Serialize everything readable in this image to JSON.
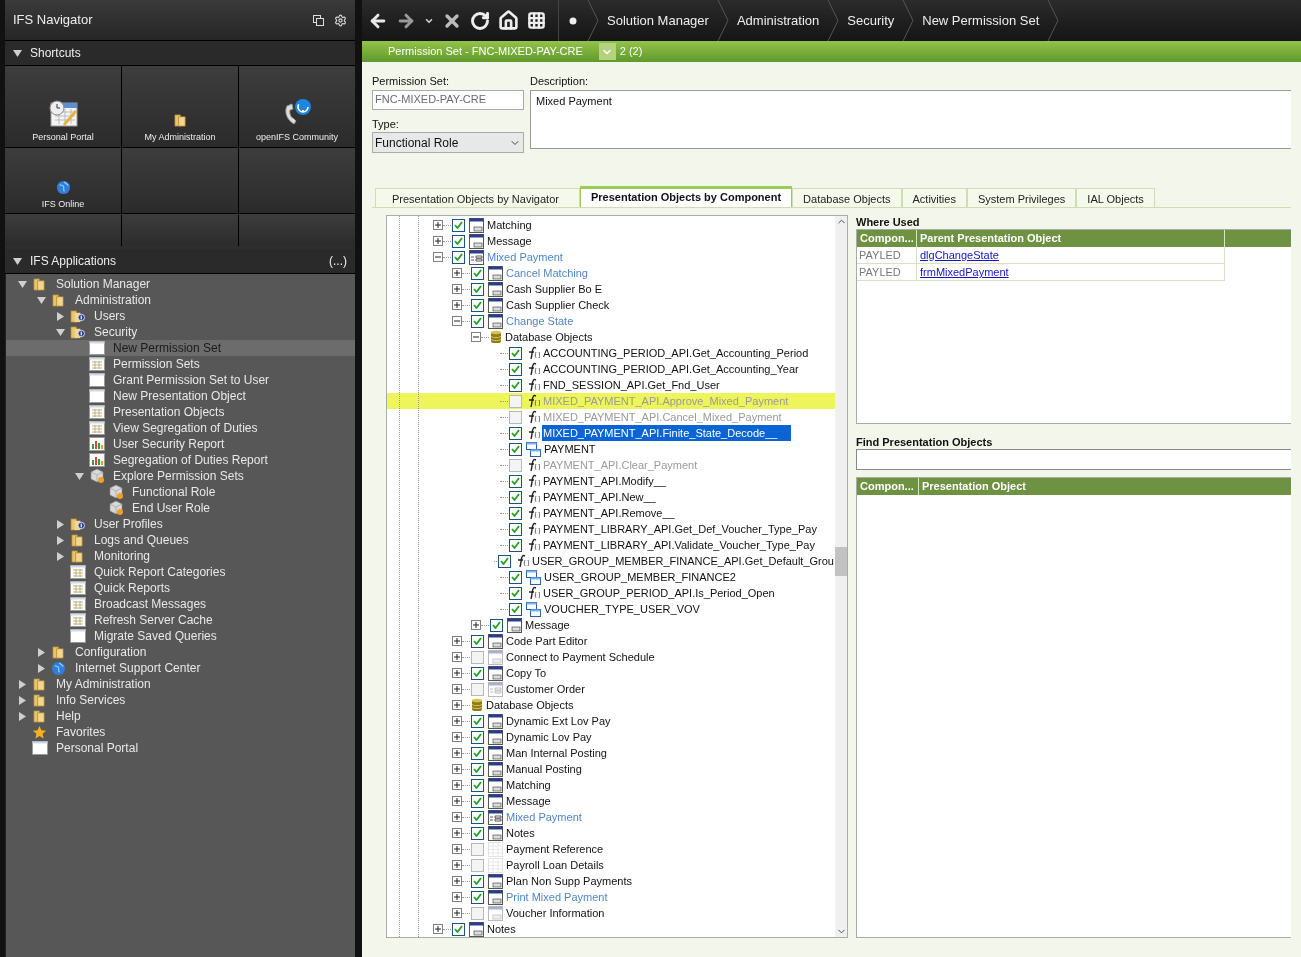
{
  "navigator": {
    "title": "IFS Navigator"
  },
  "shortcuts": {
    "title": "Shortcuts",
    "expanded": true,
    "items": [
      {
        "label": "Personal Portal",
        "kind": "calendar"
      },
      {
        "label": "My Administration",
        "kind": "folder"
      },
      {
        "label": "openIFS Community",
        "kind": "phone"
      },
      {
        "label": "IFS Online",
        "kind": "globe"
      }
    ]
  },
  "applications": {
    "title": "IFS Applications",
    "expanded": true,
    "more": "(...)",
    "items": [
      {
        "label": "Solution Manager",
        "kind": "folder",
        "expanded": true,
        "selected": false,
        "children": [
          {
            "label": "Administration",
            "kind": "folder",
            "expanded": true,
            "selected": false,
            "children": [
              {
                "label": "Users",
                "kind": "folder-info",
                "expanded": false,
                "selected": false
              },
              {
                "label": "Security",
                "kind": "folder-info",
                "expanded": true,
                "selected": false,
                "children": [
                  {
                    "label": "New Permission Set",
                    "kind": "window",
                    "selected": true
                  },
                  {
                    "label": "Permission Sets",
                    "kind": "grid",
                    "selected": false
                  },
                  {
                    "label": "Grant Permission Set to User",
                    "kind": "window",
                    "selected": false
                  },
                  {
                    "label": "New Presentation Object",
                    "kind": "window",
                    "selected": false
                  },
                  {
                    "label": "Presentation Objects",
                    "kind": "grid",
                    "selected": false
                  },
                  {
                    "label": "View Segregation of Duties",
                    "kind": "grid",
                    "selected": false
                  },
                  {
                    "label": "User Security Report",
                    "kind": "report",
                    "selected": false
                  },
                  {
                    "label": "Segregation of Duties Report",
                    "kind": "report",
                    "selected": false
                  },
                  {
                    "label": "Explore Permission Sets",
                    "kind": "cube",
                    "expanded": true,
                    "selected": false,
                    "children": [
                      {
                        "label": "Functional Role",
                        "kind": "cube",
                        "selected": false
                      },
                      {
                        "label": "End User Role",
                        "kind": "cube",
                        "selected": false
                      }
                    ]
                  }
                ]
              },
              {
                "label": "User Profiles",
                "kind": "folder-info",
                "expanded": false,
                "selected": false
              },
              {
                "label": "Logs and Queues",
                "kind": "folder",
                "expanded": false,
                "selected": false
              },
              {
                "label": "Monitoring",
                "kind": "folder",
                "expanded": false,
                "selected": false
              },
              {
                "label": "Quick Report Categories",
                "kind": "grid",
                "selected": false
              },
              {
                "label": "Quick Reports",
                "kind": "grid",
                "selected": false
              },
              {
                "label": "Broadcast Messages",
                "kind": "grid",
                "selected": false
              },
              {
                "label": "Refresh Server Cache",
                "kind": "grid",
                "selected": false
              },
              {
                "label": "Migrate Saved Queries",
                "kind": "window",
                "selected": false
              }
            ]
          },
          {
            "label": "Configuration",
            "kind": "folder",
            "expanded": false,
            "selected": false
          },
          {
            "label": "Internet Support Center",
            "kind": "globe",
            "expanded": false,
            "selected": false
          }
        ]
      },
      {
        "label": "My Administration",
        "kind": "folder",
        "expanded": false,
        "selected": false
      },
      {
        "label": "Info Services",
        "kind": "folder",
        "expanded": false,
        "selected": false
      },
      {
        "label": "Help",
        "kind": "folder",
        "expanded": false,
        "selected": false
      },
      {
        "label": "Favorites",
        "kind": "star",
        "selected": false
      },
      {
        "label": "Personal Portal",
        "kind": "window",
        "selected": false
      }
    ]
  },
  "toolbar": {
    "breadcrumbs": [
      "Solution Manager",
      "Administration",
      "Security",
      "New Permission Set"
    ]
  },
  "record_bar": {
    "title": "Permission Set - FNC-MIXED-PAY-CRE",
    "count": "2 (2)"
  },
  "form": {
    "permission_set": {
      "label": "Permission Set:",
      "value": "FNC-MIXED-PAY-CRE"
    },
    "description": {
      "label": "Description:",
      "value": "Mixed Payment"
    },
    "type": {
      "label": "Type:",
      "value": "Functional Role"
    }
  },
  "tabs": [
    {
      "label": "Presentation Objects by Navigator",
      "selected": false
    },
    {
      "label": "Presentation Objects by Component",
      "selected": true
    },
    {
      "label": "Database Objects",
      "selected": false
    },
    {
      "label": "Activities",
      "selected": false
    },
    {
      "label": "System Privileges",
      "selected": false
    },
    {
      "label": "IAL Objects",
      "selected": false
    }
  ],
  "component_tree": [
    {
      "label": "Matching",
      "kind": "dialog",
      "checked": true,
      "expanded": false,
      "link": false,
      "selected": false,
      "highlighted": false
    },
    {
      "label": "Message",
      "kind": "dialog",
      "checked": true,
      "expanded": false,
      "link": false,
      "selected": false,
      "highlighted": false
    },
    {
      "label": "Mixed Payment",
      "kind": "form",
      "checked": true,
      "expanded": true,
      "link": true,
      "selected": false,
      "highlighted": false,
      "children": [
        {
          "label": "Cancel Matching",
          "kind": "dialog",
          "checked": true,
          "expanded": false,
          "link": true,
          "selected": false,
          "highlighted": false
        },
        {
          "label": "Cash Supplier Bo E",
          "kind": "dialog",
          "checked": true,
          "expanded": false,
          "link": false,
          "selected": false,
          "highlighted": false
        },
        {
          "label": "Cash Supplier Check",
          "kind": "dialog",
          "checked": true,
          "expanded": false,
          "link": false,
          "selected": false,
          "highlighted": false
        },
        {
          "label": "Change State",
          "kind": "dialog",
          "checked": true,
          "expanded": true,
          "link": true,
          "selected": false,
          "highlighted": false,
          "children": [
            {
              "label": "Database Objects",
              "kind": "db",
              "expanded": true,
              "link": false,
              "selected": false,
              "highlighted": false,
              "children": [
                {
                  "label": "ACCOUNTING_PERIOD_API.Get_Accounting_Period",
                  "kind": "function",
                  "checked": true,
                  "link": false,
                  "selected": false,
                  "highlighted": false
                },
                {
                  "label": "ACCOUNTING_PERIOD_API.Get_Accounting_Year",
                  "kind": "function",
                  "checked": true,
                  "link": false,
                  "selected": false,
                  "highlighted": false
                },
                {
                  "label": "FND_SESSION_API.Get_Fnd_User",
                  "kind": "function",
                  "checked": true,
                  "link": false,
                  "selected": false,
                  "highlighted": false
                },
                {
                  "label": "MIXED_PAYMENT_API.Approve_Mixed_Payment",
                  "kind": "function",
                  "checked": false,
                  "link": false,
                  "selected": false,
                  "highlighted": true
                },
                {
                  "label": "MIXED_PAYMENT_API.Cancel_Mixed_Payment",
                  "kind": "function",
                  "checked": false,
                  "link": false,
                  "selected": false,
                  "highlighted": false
                },
                {
                  "label": "MIXED_PAYMENT_API.Finite_State_Decode__",
                  "kind": "function",
                  "checked": true,
                  "link": false,
                  "selected": true,
                  "highlighted": false
                },
                {
                  "label": "PAYMENT",
                  "kind": "table",
                  "checked": true,
                  "link": false,
                  "selected": false,
                  "highlighted": false
                },
                {
                  "label": "PAYMENT_API.Clear_Payment",
                  "kind": "function",
                  "checked": false,
                  "link": false,
                  "selected": false,
                  "highlighted": false
                },
                {
                  "label": "PAYMENT_API.Modify__",
                  "kind": "function",
                  "checked": true,
                  "link": false,
                  "selected": false,
                  "highlighted": false
                },
                {
                  "label": "PAYMENT_API.New__",
                  "kind": "function",
                  "checked": true,
                  "link": false,
                  "selected": false,
                  "highlighted": false
                },
                {
                  "label": "PAYMENT_API.Remove__",
                  "kind": "function",
                  "checked": true,
                  "link": false,
                  "selected": false,
                  "highlighted": false
                },
                {
                  "label": "PAYMENT_LIBRARY_API.Get_Def_Voucher_Type_Pay",
                  "kind": "function",
                  "checked": true,
                  "link": false,
                  "selected": false,
                  "highlighted": false
                },
                {
                  "label": "PAYMENT_LIBRARY_API.Validate_Voucher_Type_Pay",
                  "kind": "function",
                  "checked": true,
                  "link": false,
                  "selected": false,
                  "highlighted": false
                },
                {
                  "label": "USER_GROUP_MEMBER_FINANCE_API.Get_Default_Grou",
                  "kind": "function",
                  "checked": true,
                  "link": false,
                  "selected": false,
                  "highlighted": false
                },
                {
                  "label": "USER_GROUP_MEMBER_FINANCE2",
                  "kind": "table",
                  "checked": true,
                  "link": false,
                  "selected": false,
                  "highlighted": false
                },
                {
                  "label": "USER_GROUP_PERIOD_API.Is_Period_Open",
                  "kind": "function",
                  "checked": true,
                  "link": false,
                  "selected": false,
                  "highlighted": false
                },
                {
                  "label": "VOUCHER_TYPE_USER_VOV",
                  "kind": "table",
                  "checked": true,
                  "link": false,
                  "selected": false,
                  "highlighted": false
                }
              ]
            },
            {
              "label": "Message",
              "kind": "dialog",
              "checked": true,
              "expanded": false,
              "link": false,
              "selected": false,
              "highlighted": false
            }
          ]
        },
        {
          "label": "Code Part Editor",
          "kind": "dialog",
          "checked": true,
          "expanded": false,
          "link": false,
          "selected": false,
          "highlighted": false
        },
        {
          "label": "Connect to Payment Schedule",
          "kind": "dialog",
          "checked": false,
          "expanded": false,
          "link": false,
          "selected": false,
          "highlighted": false
        },
        {
          "label": "Copy To",
          "kind": "dialog",
          "checked": true,
          "expanded": false,
          "link": false,
          "selected": false,
          "highlighted": false
        },
        {
          "label": "Customer Order",
          "kind": "form",
          "checked": false,
          "expanded": false,
          "link": false,
          "selected": false,
          "highlighted": false
        },
        {
          "label": "Database Objects",
          "kind": "db",
          "expanded": false,
          "link": false,
          "selected": false,
          "highlighted": false
        },
        {
          "label": "Dynamic Ext Lov Pay",
          "kind": "dialog",
          "checked": true,
          "expanded": false,
          "link": false,
          "selected": false,
          "highlighted": false
        },
        {
          "label": "Dynamic Lov Pay",
          "kind": "dialog",
          "checked": true,
          "expanded": false,
          "link": false,
          "selected": false,
          "highlighted": false
        },
        {
          "label": "Man Internal Posting",
          "kind": "dialog",
          "checked": true,
          "expanded": false,
          "link": false,
          "selected": false,
          "highlighted": false
        },
        {
          "label": "Manual Posting",
          "kind": "dialog",
          "checked": true,
          "expanded": false,
          "link": false,
          "selected": false,
          "highlighted": false
        },
        {
          "label": "Matching",
          "kind": "dialog",
          "checked": true,
          "expanded": false,
          "link": false,
          "selected": false,
          "highlighted": false
        },
        {
          "label": "Message",
          "kind": "dialog",
          "checked": true,
          "expanded": false,
          "link": false,
          "selected": false,
          "highlighted": false
        },
        {
          "label": "Mixed Payment",
          "kind": "form",
          "checked": true,
          "expanded": false,
          "link": true,
          "selected": false,
          "highlighted": false
        },
        {
          "label": "Notes",
          "kind": "dialog",
          "checked": true,
          "expanded": false,
          "link": false,
          "selected": false,
          "highlighted": false
        },
        {
          "label": "Payment Reference",
          "kind": "grid",
          "checked": false,
          "expanded": false,
          "link": false,
          "selected": false,
          "highlighted": false
        },
        {
          "label": "Payroll Loan Details",
          "kind": "grid",
          "checked": false,
          "expanded": false,
          "link": false,
          "selected": false,
          "highlighted": false
        },
        {
          "label": "Plan Non Supp Payments",
          "kind": "dialog",
          "checked": true,
          "expanded": false,
          "link": false,
          "selected": false,
          "highlighted": false
        },
        {
          "label": "Print Mixed Payment",
          "kind": "dialog",
          "checked": true,
          "expanded": false,
          "link": true,
          "selected": false,
          "highlighted": false
        },
        {
          "label": "Voucher Information",
          "kind": "dialog",
          "checked": false,
          "expanded": false,
          "link": false,
          "selected": false,
          "highlighted": false
        }
      ]
    },
    {
      "label": "Notes",
      "kind": "dialog",
      "checked": true,
      "expanded": false,
      "link": false,
      "selected": false,
      "highlighted": false
    }
  ],
  "where_used": {
    "title": "Where Used",
    "columns": [
      "Compon...",
      "Parent Presentation Object"
    ],
    "rows": [
      [
        "PAYLED",
        "dlgChangeState"
      ],
      [
        "PAYLED",
        "frmMixedPayment"
      ]
    ]
  },
  "find": {
    "title": "Find Presentation Objects",
    "columns": [
      "Compon...",
      "Presentation Object"
    ]
  }
}
